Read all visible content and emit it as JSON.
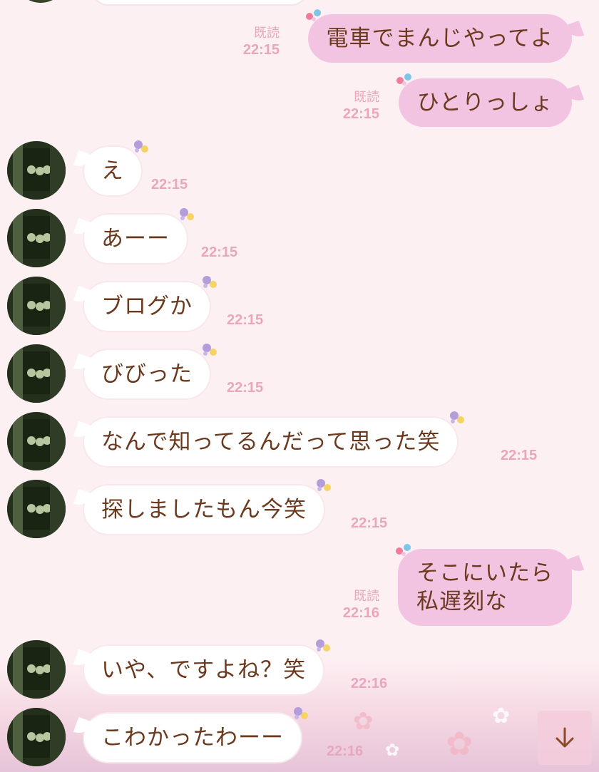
{
  "colors": {
    "background": "#fdf0f3",
    "sent_bubble": "#f3c3e2",
    "received_bubble": "#ffffff",
    "message_text": "#6b3a1e",
    "meta_text": "#e8a7bd"
  },
  "sent_messages": [
    {
      "text": "電車でまんじやってよ",
      "read_label": "既読",
      "time": "22:15"
    },
    {
      "text": "ひとりっしょ",
      "read_label": "既読",
      "time": "22:15"
    },
    {
      "line1": "そこにいたら",
      "line2": "私遅刻な",
      "read_label": "既読",
      "time": "22:16"
    }
  ],
  "received_messages": [
    {
      "text": "え",
      "time": "22:15"
    },
    {
      "text": "あーー",
      "time": "22:15"
    },
    {
      "text": "ブログか",
      "time": "22:15"
    },
    {
      "text": "びびった",
      "time": "22:15"
    },
    {
      "text": "なんで知ってるんだって思った笑",
      "time": "22:15"
    },
    {
      "text": "探しましたもん今笑",
      "time": "22:15"
    },
    {
      "text": "いや、ですよね？笑",
      "time": "22:16"
    },
    {
      "text": "こわかったわーー",
      "time": "22:16"
    }
  ],
  "scroll_button": {
    "icon": "arrow-down-icon"
  }
}
